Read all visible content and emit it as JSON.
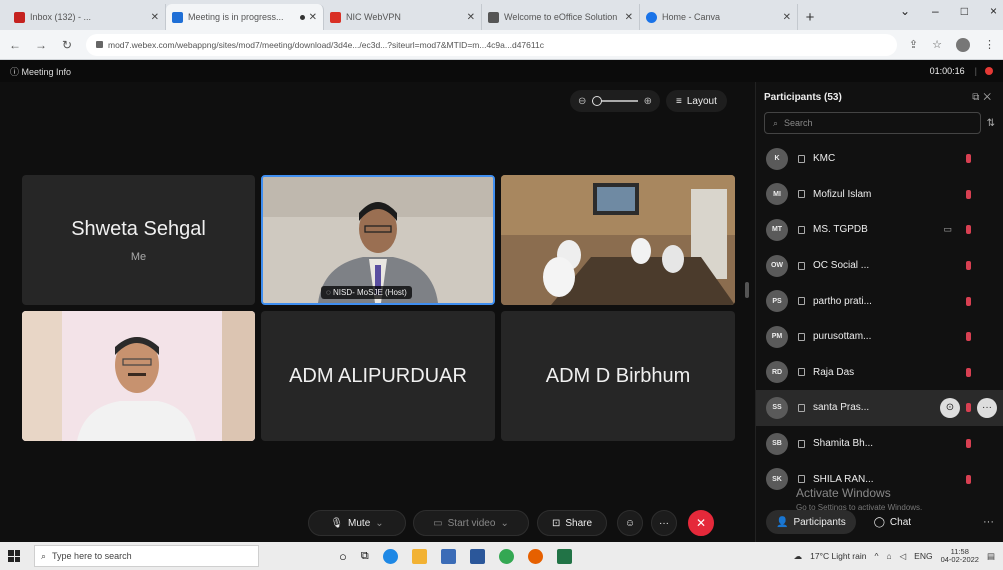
{
  "browser": {
    "tabs": [
      {
        "label": "Inbox (132) - ...",
        "favicon_color": "#c5221f",
        "active": false
      },
      {
        "label": "Meeting is in progress...",
        "favicon_color": "#1f6fd6",
        "active": true
      },
      {
        "label": "NIC WebVPN",
        "favicon_color": "#d93025",
        "active": false
      },
      {
        "label": "Welcome to eOffice Solution",
        "favicon_color": "#555555",
        "active": false
      },
      {
        "label": "Home - Canva",
        "favicon_color": "#1a73e8",
        "active": false
      }
    ],
    "new_tab": "+",
    "window_controls": {
      "min": "–",
      "max": "□",
      "close": "×"
    },
    "url": "mod7.webex.com/webappng/sites/mod7/meeting/download/3d4e.../ec3d...?siteurl=mod7&MTID=m...4c9a...d47611c"
  },
  "meeting": {
    "info_label": "Meeting Info",
    "timer": "01:00:16",
    "layout_label": "Layout",
    "host_label": "NISD- MoSJE (Host)"
  },
  "tiles": [
    {
      "name": "Shweta Sehgal",
      "sub": "Me"
    },
    {
      "name": "ADM ALIPURDUAR"
    },
    {
      "name": "ADM D Birbhum"
    }
  ],
  "controls": {
    "mute": "Mute",
    "start_video": "Start video",
    "share": "Share"
  },
  "participants_panel": {
    "title": "Participants (53)",
    "search_placeholder": "Search",
    "items": [
      {
        "initials": "K",
        "name": "KMC"
      },
      {
        "initials": "MI",
        "name": "Mofizul Islam"
      },
      {
        "initials": "MT",
        "name": "MS. TGPDB"
      },
      {
        "initials": "OW",
        "name": "OC Social ..."
      },
      {
        "initials": "PS",
        "name": "partho prati..."
      },
      {
        "initials": "PM",
        "name": "purusottam..."
      },
      {
        "initials": "RD",
        "name": "Raja Das"
      },
      {
        "initials": "SS",
        "name": "santa Pras..."
      },
      {
        "initials": "SB",
        "name": "Shamita Bh..."
      },
      {
        "initials": "SK",
        "name": "SHILA RAN..."
      }
    ],
    "watermark_title": "Activate Windows",
    "watermark_sub": "Go to Settings to activate Windows.",
    "footer_participants": "Participants",
    "footer_chat": "Chat"
  },
  "taskbar": {
    "search_placeholder": "Type here to search",
    "weather": "17°C Light rain",
    "language": "ENG",
    "time": "11:58",
    "date": "04-02-2022"
  }
}
